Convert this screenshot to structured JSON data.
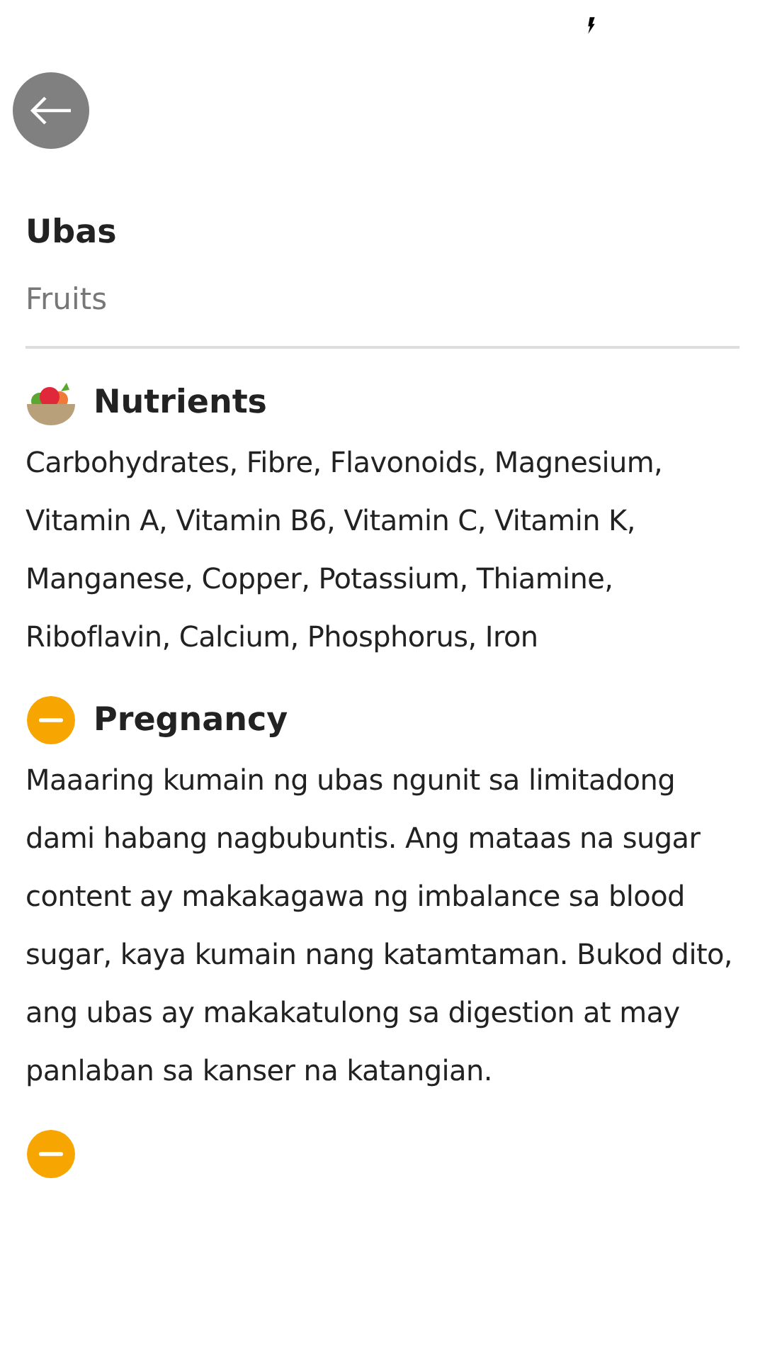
{
  "food": {
    "name": "Ubas",
    "category": "Fruits"
  },
  "sections": [
    {
      "kind": "nutrients",
      "title": "Nutrients",
      "body": "Carbohydrates, Fibre, Flavonoids, Magnesium, Vitamin A, Vitamin B6, Vitamin C, Vitamin K, Manganese, Copper, Potassium, Thiamine, Riboflavin, Calcium, Phosphorus, Iron"
    },
    {
      "kind": "caution",
      "title": "Pregnancy",
      "body": "Maaaring kumain ng ubas ngunit sa limitadong dami habang nagbubuntis. Ang mataas na sugar content ay makakagawa ng imbalance sa blood sugar, kaya kumain nang katamtaman. Bukod dito, ang ubas ay makakatulong sa digestion at may panlaban sa kanser na katangian."
    },
    {
      "kind": "caution"
    }
  ]
}
